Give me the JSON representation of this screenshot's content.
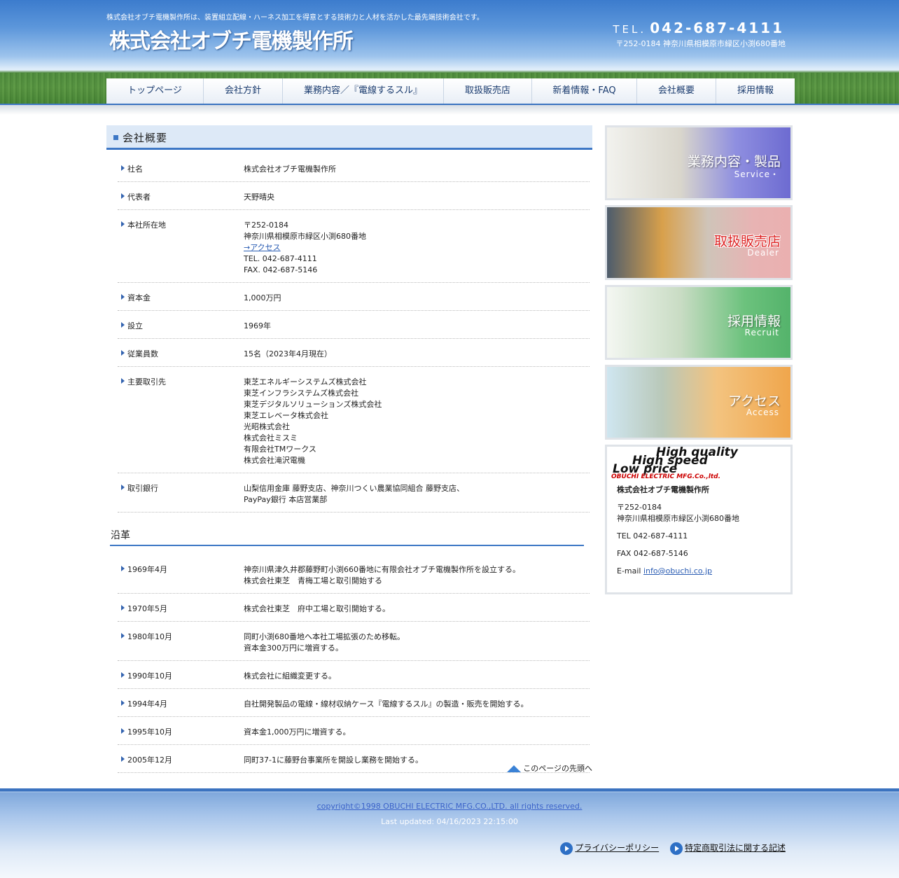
{
  "header": {
    "tagline": "株式会社オブチ電機製作所は、装置組立配線・ハーネス加工を得意とする技術力と人材を活かした最先端技術会社です。",
    "logo": "株式会社オブチ電機製作所",
    "tel_label": "TEL.",
    "tel_number": "042-687-4111",
    "address": "〒252-0184 神奈川県相模原市緑区小渕680番地"
  },
  "nav": [
    "トップページ",
    "会社方針",
    "業務内容／『電線するスル』",
    "取扱販売店",
    "新着情報・FAQ",
    "会社概要",
    "採用情報"
  ],
  "main": {
    "title": "会社概要",
    "company": {
      "name_label": "社名",
      "name": "株式会社オブチ電機製作所",
      "rep_label": "代表者",
      "rep": "天野晴央",
      "hq_label": "本社所在地",
      "hq_postal": "〒252-0184",
      "hq_addr": "神奈川県相模原市緑区小渕680番地",
      "hq_access": "→アクセス",
      "hq_tel": "TEL. 042-687-4111",
      "hq_fax": "FAX. 042-687-5146",
      "capital_label": "資本金",
      "capital": "1,000万円",
      "founded_label": "設立",
      "founded": "1969年",
      "employees_label": "従業員数",
      "employees": "15名（2023年4月現在）",
      "clients_label": "主要取引先",
      "clients": [
        "東芝エネルギーシステムズ株式会社",
        "東芝インフラシステムズ株式会社",
        "東芝デジタルソリューションズ株式会社",
        "東芝エレベータ株式会社",
        "光昭株式会社",
        "株式会社ミスミ",
        "有限会社TMワークス",
        "株式会社滝沢電機"
      ],
      "banks_label": "取引銀行",
      "banks": [
        "山梨信用金庫 藤野支店、神奈川つくい農業協同組合 藤野支店、",
        "PayPay銀行 本店営業部"
      ]
    },
    "history_title": "沿革",
    "history": [
      {
        "date": "1969年4月",
        "lines": [
          "神奈川県津久井郡藤野町小渕660番地に有限会社オブチ電機製作所を設立する。",
          "株式会社東芝　青梅工場と取引開始する"
        ]
      },
      {
        "date": "1970年5月",
        "lines": [
          "株式会社東芝　府中工場と取引開始する。"
        ]
      },
      {
        "date": "1980年10月",
        "lines": [
          "同町小渕680番地へ本社工場拡張のため移転。",
          "資本金300万円に増資する。"
        ]
      },
      {
        "date": "1990年10月",
        "lines": [
          "株式会社に組織変更する。"
        ]
      },
      {
        "date": "1994年4月",
        "lines": [
          "自社開発製品の電線・線材収納ケース『電線するスル』の製造・販売を開始する。"
        ]
      },
      {
        "date": "1995年10月",
        "lines": [
          "資本金1,000万円に増資する。"
        ]
      },
      {
        "date": "2005年12月",
        "lines": [
          "同町37-1に藤野台事業所を開設し業務を開始する。"
        ]
      }
    ],
    "to_top": "このページの先頭へ"
  },
  "side": {
    "banners": [
      {
        "title": "業務内容・製品",
        "sub": "Service・"
      },
      {
        "title": "取扱販売店",
        "sub": "Dealer"
      },
      {
        "title": "採用情報",
        "sub": "Recruit"
      },
      {
        "title": "アクセス",
        "sub": "Access"
      }
    ],
    "card": {
      "slogan1": "High quality",
      "slogan2": "High speed",
      "slogan3": "Low price",
      "slogan4": "OBUCHI ELECTRIC MFG.Co.,ltd.",
      "name": "株式会社オブチ電機製作所",
      "postal": "〒252-0184",
      "addr": "神奈川県相模原市緑区小渕680番地",
      "tel": "TEL 042-687-4111",
      "fax": "FAX 042-687-5146",
      "email_label": "E-mail",
      "email": "info@obuchi.co.jp"
    }
  },
  "footer": {
    "copyright": "copyright©1998 OBUCHI ELECTRIC MFG.CO.,LTD. all rights reserved.",
    "updated": "Last updated: 04/16/2023 22:15:00",
    "privacy": "プライバシーポリシー",
    "tokutei": "特定商取引法に関する記述"
  },
  "colors": {
    "accent": "#3d77c5",
    "title_bg": "#dde9f7",
    "link": "#2a5cb3"
  }
}
